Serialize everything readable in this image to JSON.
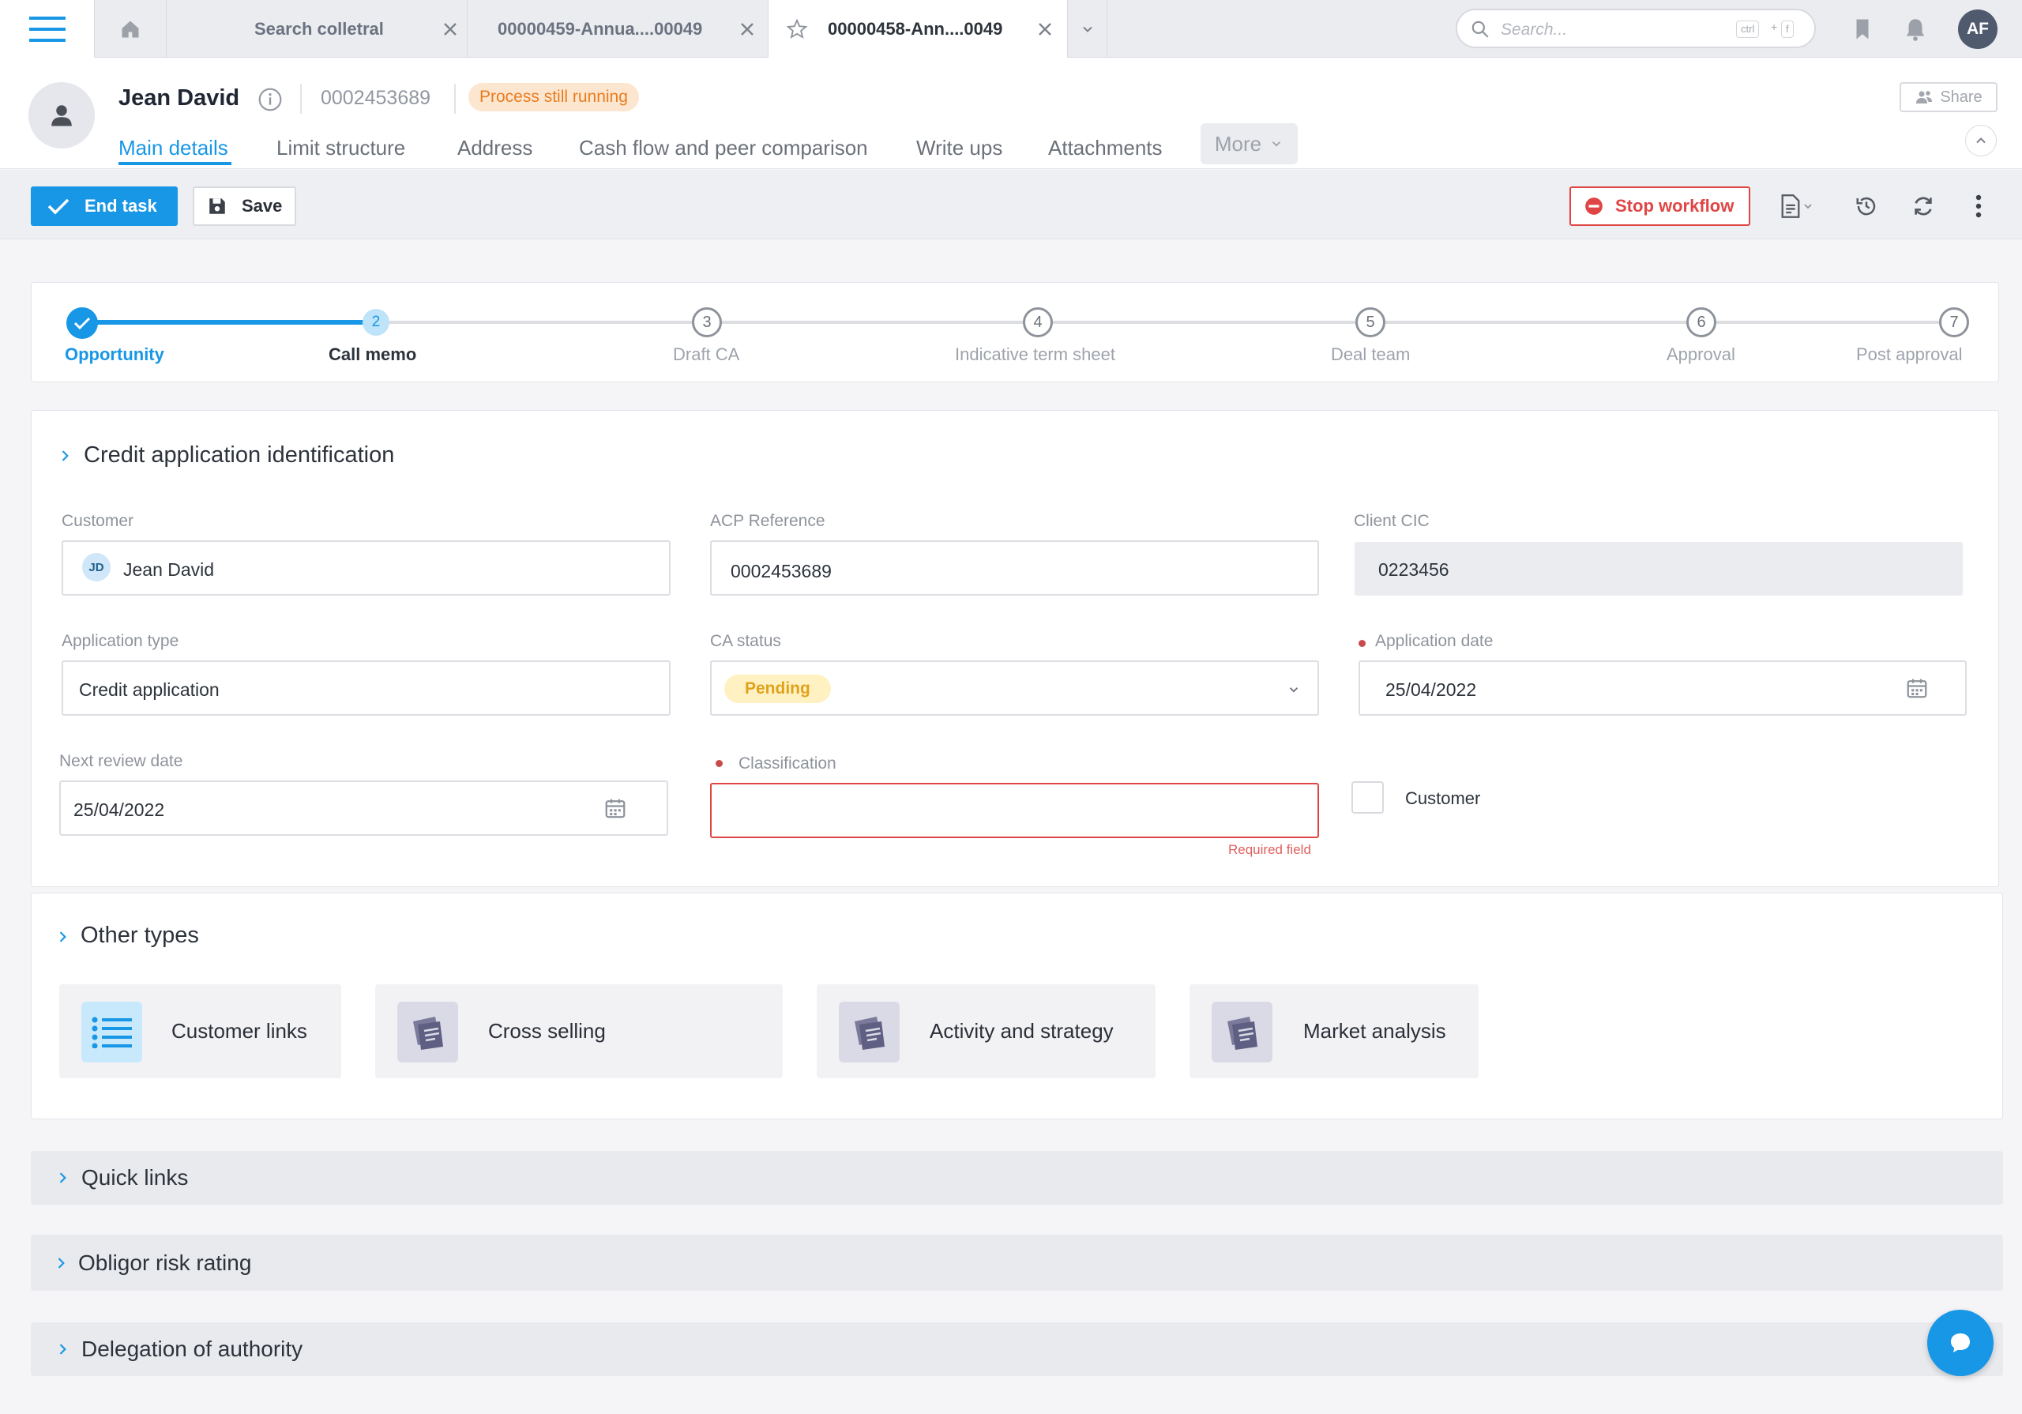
{
  "topbar": {
    "tabs": [
      {
        "label": "Search colletral"
      },
      {
        "label": "00000459-Annua....00049"
      },
      {
        "label": "00000458-Ann....0049"
      }
    ],
    "search_placeholder": "Search...",
    "kbd_ctrl": "ctrl",
    "kbd_plus": "+",
    "kbd_f": "f",
    "avatar_initials": "AF"
  },
  "header": {
    "name": "Jean David",
    "reference": "0002453689",
    "status_badge": "Process still running",
    "share_label": "Share",
    "nav_tabs": [
      "Main details",
      "Limit structure",
      "Address",
      "Cash flow and peer comparison",
      "Write ups",
      "Attachments"
    ],
    "more_label": "More"
  },
  "toolbar": {
    "end_task_label": "End task",
    "save_label": "Save",
    "stop_workflow_label": "Stop workflow"
  },
  "stepper": {
    "steps": [
      {
        "num": "1",
        "label": "Opportunity",
        "state": "done"
      },
      {
        "num": "2",
        "label": "Call memo",
        "state": "current"
      },
      {
        "num": "3",
        "label": "Draft CA",
        "state": "todo"
      },
      {
        "num": "4",
        "label": "Indicative term sheet",
        "state": "todo"
      },
      {
        "num": "5",
        "label": "Deal team",
        "state": "todo"
      },
      {
        "num": "6",
        "label": "Approval",
        "state": "todo"
      },
      {
        "num": "7",
        "label": "Post approval",
        "state": "todo"
      }
    ]
  },
  "form": {
    "section_title": "Credit application identification",
    "customer": {
      "label": "Customer",
      "value": "Jean David",
      "initials": "JD"
    },
    "acp_reference": {
      "label": "ACP Reference",
      "value": "0002453689"
    },
    "client_cic": {
      "label": "Client CIC",
      "value": "0223456"
    },
    "application_type": {
      "label": "Application type",
      "value": "Credit application"
    },
    "ca_status": {
      "label": "CA status",
      "value": "Pending"
    },
    "application_date": {
      "label": "Application date",
      "value": "25/04/2022"
    },
    "next_review_date": {
      "label": "Next review date",
      "value": "25/04/2022"
    },
    "classification": {
      "label": "Classification",
      "value": "",
      "error": "Required field"
    },
    "customer_checkbox": {
      "label": "Customer"
    }
  },
  "other_types": {
    "title": "Other types",
    "tiles": [
      "Customer links",
      "Cross selling",
      "Activity and strategy",
      "Market analysis"
    ]
  },
  "collapsed_sections": [
    "Quick links",
    "Obligor risk rating",
    "Delegation of authority"
  ],
  "colors": {
    "accent": "#1897e6",
    "danger": "#e04545",
    "warning_bg": "#fde6cf",
    "pending_bg": "#fff1c2"
  }
}
